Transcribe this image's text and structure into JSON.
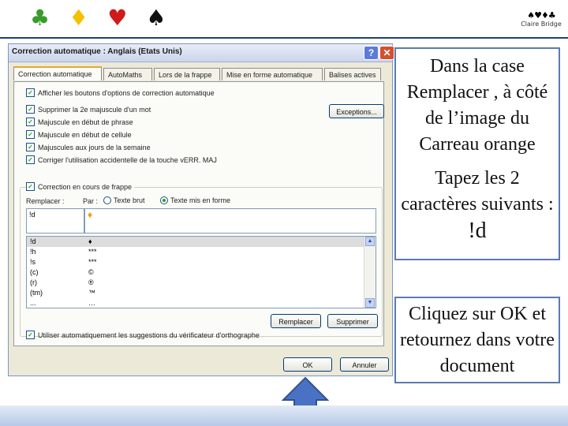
{
  "header": {
    "suits": [
      {
        "symbol": "♣",
        "color": "#3a9c2a"
      },
      {
        "symbol": "♦",
        "color": "#f2c200"
      },
      {
        "symbol": "♥",
        "color": "#d11a1a"
      },
      {
        "symbol": "♠",
        "color": "#111111"
      }
    ],
    "logo_suits": "♠♥♦♣",
    "logo_text": "Claire Bridge"
  },
  "dialog": {
    "title": "Correction automatique : Anglais (Etats Unis)",
    "help_label": "?",
    "close_label": "✕",
    "tabs": [
      {
        "label": "Correction automatique",
        "active": true
      },
      {
        "label": "AutoMaths",
        "active": false
      },
      {
        "label": "Lors de la frappe",
        "active": false
      },
      {
        "label": "Mise en forme automatique",
        "active": false
      },
      {
        "label": "Balises actives",
        "active": false
      }
    ],
    "options": [
      {
        "label": "Afficher les boutons d'options de correction automatique",
        "checked": true
      },
      {
        "label": "Supprimer la 2e majuscule d'un mot",
        "checked": true
      },
      {
        "label": "Majuscule en début de phrase",
        "checked": true
      },
      {
        "label": "Majuscule en début de cellule",
        "checked": true
      },
      {
        "label": "Majuscules aux jours de la semaine",
        "checked": true
      },
      {
        "label": "Corriger l'utilisation accidentelle de la touche vERR. MAJ",
        "checked": true
      }
    ],
    "exceptions_button": "Exceptions...",
    "replace_group": {
      "title": "Correction en cours de frappe",
      "checked": true,
      "replace_label": "Remplacer :",
      "by_label": "Par :",
      "plain_text_option": "Texte brut",
      "formatted_text_option": "Texte mis en forme",
      "selected_option": "formatted",
      "replace_value": "!d",
      "by_value": "♦",
      "by_value_color": "#f39c12"
    },
    "list_rows": [
      {
        "key": "!d",
        "value": "♦",
        "selected": true
      },
      {
        "key": "!h",
        "value": "***"
      },
      {
        "key": "!s",
        "value": "***"
      },
      {
        "key": "(c)",
        "value": "©"
      },
      {
        "key": "(r)",
        "value": "®"
      },
      {
        "key": "(tm)",
        "value": "™"
      },
      {
        "key": "...",
        "value": "…"
      }
    ],
    "replace_button": "Remplacer",
    "delete_button": "Supprimer",
    "spell_option": {
      "label": "Utiliser automatiquement les suggestions du vérificateur d'orthographe",
      "checked": true
    },
    "ok_button": "OK",
    "cancel_button": "Annuler"
  },
  "callouts": {
    "first_text": "Dans la case Remplacer , à côté de l’image du Carreau orange",
    "second_text": "Tapez les 2 caractères suivants :",
    "second_value": "!d",
    "third_text": "Cliquez sur OK et retournez dans votre document"
  },
  "colors": {
    "callout_border": "#5b7bb0",
    "arrow_fill": "#4a72c4",
    "header_line": "#1f3f7a"
  }
}
